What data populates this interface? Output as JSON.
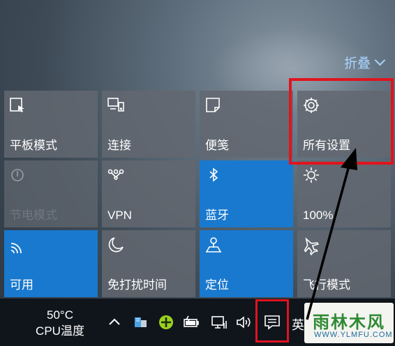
{
  "header": {
    "collapse_label": "折叠"
  },
  "tiles": [
    {
      "label": "平板模式",
      "icon": "tablet-mode-icon",
      "state": "off"
    },
    {
      "label": "连接",
      "icon": "connect-icon",
      "state": "off"
    },
    {
      "label": "便笺",
      "icon": "note-icon",
      "state": "off"
    },
    {
      "label": "所有设置",
      "icon": "gear-icon",
      "state": "off"
    },
    {
      "label": "节电模式",
      "icon": "battery-saver-icon",
      "state": "disabled"
    },
    {
      "label": "VPN",
      "icon": "vpn-icon",
      "state": "off"
    },
    {
      "label": "蓝牙",
      "icon": "bluetooth-icon",
      "state": "on"
    },
    {
      "label": "100%",
      "icon": "brightness-icon",
      "state": "off"
    },
    {
      "label": "可用",
      "icon": "wifi-icon",
      "state": "on"
    },
    {
      "label": "免打扰时间",
      "icon": "moon-icon",
      "state": "off"
    },
    {
      "label": "定位",
      "icon": "location-icon",
      "state": "on"
    },
    {
      "label": "飞行模式",
      "icon": "airplane-icon",
      "state": "off"
    }
  ],
  "taskbar": {
    "cpu_temp": "50°C",
    "cpu_label": "CPU温度",
    "ime": "英"
  },
  "watermark": {
    "title": "雨林木风",
    "url": "WWW.YLMFU.COM"
  },
  "colors": {
    "accent": "#1979ce",
    "tile": "#62686f",
    "highlight": "#e0141e"
  }
}
